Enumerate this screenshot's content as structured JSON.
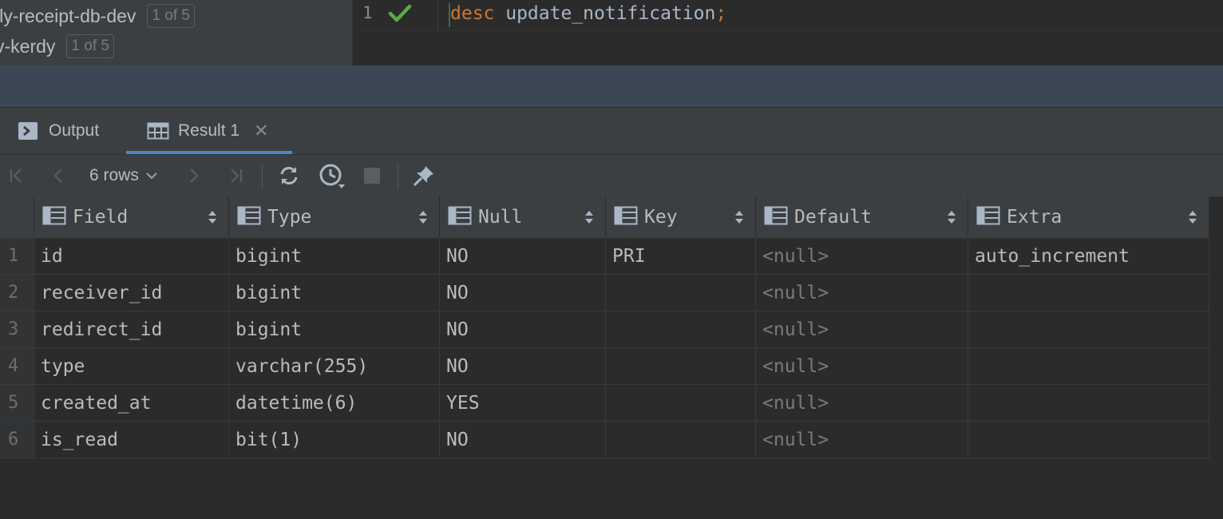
{
  "sessions": [
    {
      "name": "ily-receipt-db-dev",
      "count": "1 of 5"
    },
    {
      "name": "v-kerdy",
      "count": "1 of 5"
    }
  ],
  "editor": {
    "line_number": "1",
    "code_keyword": "desc",
    "code_rest": " update_notification",
    "code_semicolon": ";",
    "status_icon": "check-icon",
    "status_color": "#5fa84a"
  },
  "tabs": [
    {
      "label": "Output",
      "icon": "console-icon"
    },
    {
      "label": "Result 1",
      "icon": "table-icon",
      "close": "✕",
      "active": true
    }
  ],
  "toolbar": {
    "rows_label": "6 rows",
    "buttons": [
      "first-page-icon",
      "previous-page-icon",
      "next-page-icon",
      "last-page-icon",
      "refresh-icon",
      "history-icon",
      "stop-icon",
      "pin-icon"
    ]
  },
  "grid": {
    "columns": [
      "Field",
      "Type",
      "Null",
      "Key",
      "Default",
      "Extra"
    ],
    "rows": [
      {
        "num": "1",
        "cells": [
          "id",
          "bigint",
          "NO",
          "PRI",
          "<null>",
          "auto_increment"
        ]
      },
      {
        "num": "2",
        "cells": [
          "receiver_id",
          "bigint",
          "NO",
          "",
          "<null>",
          ""
        ]
      },
      {
        "num": "3",
        "cells": [
          "redirect_id",
          "bigint",
          "NO",
          "",
          "<null>",
          ""
        ]
      },
      {
        "num": "4",
        "cells": [
          "type",
          "varchar(255)",
          "NO",
          "",
          "<null>",
          ""
        ]
      },
      {
        "num": "5",
        "cells": [
          "created_at",
          "datetime(6)",
          "YES",
          "",
          "<null>",
          ""
        ]
      },
      {
        "num": "6",
        "cells": [
          "is_read",
          "bit(1)",
          "NO",
          "",
          "<null>",
          ""
        ]
      }
    ]
  },
  "colors": {
    "accent": "#4a88c7",
    "keyword": "#cc7832",
    "null_text": "#7a7a7a"
  }
}
